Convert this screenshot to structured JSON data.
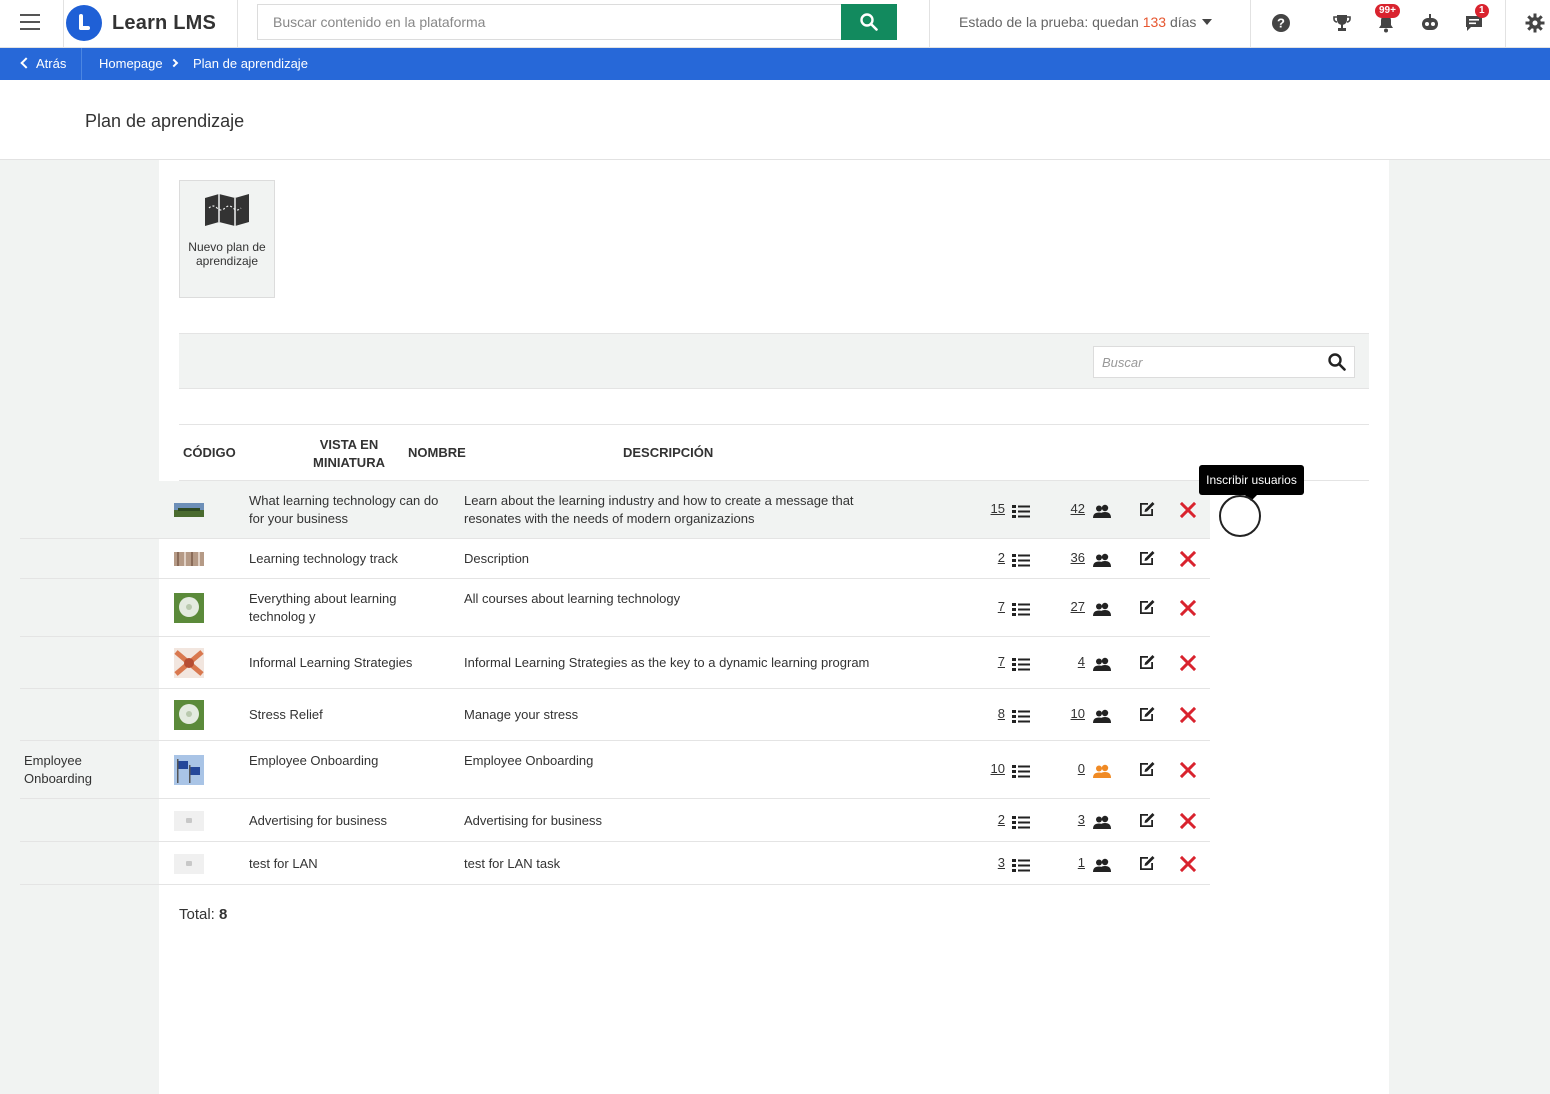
{
  "header": {
    "brand": "Learn LMS",
    "search_placeholder": "Buscar contenido en la plataforma",
    "trial_prefix": "Estado de la prueba: quedan ",
    "trial_days": "133",
    "trial_suffix": " días",
    "notifications_badge": "99+",
    "messages_badge": "1"
  },
  "breadcrumb": {
    "back": "Atrás",
    "home": "Homepage",
    "current": "Plan de aprendizaje"
  },
  "page": {
    "title": "Plan de aprendizaje",
    "new_tile_label": "Nuevo plan de aprendizaje"
  },
  "filter": {
    "search_placeholder": "Buscar"
  },
  "table": {
    "headers": {
      "code": "Código",
      "thumbnail": "Vista en miniatura",
      "name": "Nombre",
      "description": "Descripción"
    },
    "rows": [
      {
        "code": "",
        "name": "What learning technology can do for your business",
        "description": "Learn about the learning industry and how to create a message that resonates with the needs of modern organizazions",
        "courses": "15",
        "users": "42",
        "thumb": "landscape"
      },
      {
        "code": "",
        "name": "Learning technology track",
        "description": "Description",
        "courses": "2",
        "users": "36",
        "thumb": "wood"
      },
      {
        "code": "",
        "name": "Everything about learning technolog y",
        "description": "All courses about learning technology",
        "courses": "7",
        "users": "27",
        "thumb": "dandelion"
      },
      {
        "code": "",
        "name": "Informal Learning Strategies",
        "description": "Informal Learning Strategies as the key to a dynamic learning program",
        "courses": "7",
        "users": "4",
        "thumb": "hands"
      },
      {
        "code": "",
        "name": "Stress Relief",
        "description": "Manage your stress",
        "courses": "8",
        "users": "10",
        "thumb": "dandelion"
      },
      {
        "code": "Employee Onboarding",
        "name": "Employee Onboarding",
        "description": "Employee Onboarding",
        "courses": "10",
        "users": "0",
        "thumb": "flags"
      },
      {
        "code": "",
        "name": "Advertising for business",
        "description": "Advertising for business",
        "courses": "2",
        "users": "3",
        "thumb": "placeholder"
      },
      {
        "code": "",
        "name": "test for LAN",
        "description": "test for LAN task",
        "courses": "3",
        "users": "1",
        "thumb": "placeholder"
      }
    ]
  },
  "tooltip": "Inscribir usuarios",
  "total": {
    "label": "Total: ",
    "value": "8"
  },
  "colors": {
    "brand_blue": "#2768d8",
    "search_green": "#128a5e",
    "delete_red": "#d9232e",
    "warning_orange": "#f08a24",
    "trial_days": "#e6562f"
  },
  "icons": {
    "menu": "hamburger-icon",
    "search": "search-icon",
    "help": "help-icon",
    "trophy": "trophy-icon",
    "notifications": "bell-icon",
    "robot": "robot-icon",
    "messages": "chat-icon",
    "settings": "gear-icon",
    "courses": "list-icon",
    "users": "users-icon",
    "edit": "edit-icon",
    "delete": "close-icon",
    "new_plan": "map-icon"
  }
}
